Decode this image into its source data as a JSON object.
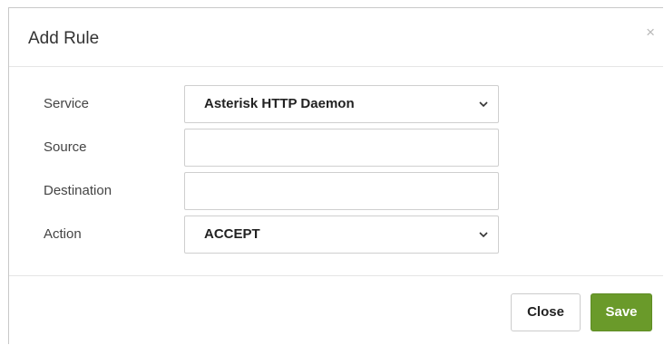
{
  "dialog": {
    "title": "Add Rule",
    "close_symbol": "×"
  },
  "form": {
    "service": {
      "label": "Service",
      "selected": "Asterisk HTTP Daemon"
    },
    "source": {
      "label": "Source",
      "value": ""
    },
    "destination": {
      "label": "Destination",
      "value": ""
    },
    "action": {
      "label": "Action",
      "selected": "ACCEPT"
    }
  },
  "footer": {
    "close_label": "Close",
    "save_label": "Save"
  },
  "colors": {
    "save_button": "#6a9a2a",
    "border": "#cfcfcf"
  },
  "icons": [
    "close-icon",
    "chevron-down-icon"
  ]
}
